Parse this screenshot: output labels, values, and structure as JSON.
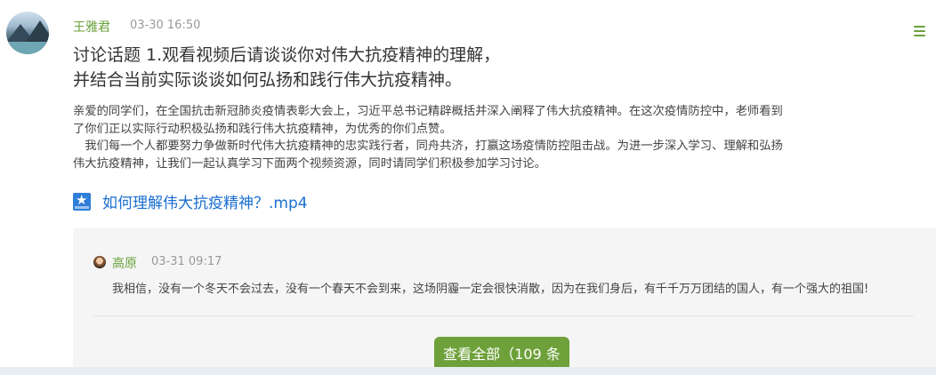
{
  "post": {
    "author": "王雅君",
    "time": "03-30 16:50",
    "title_line1": "讨论话题 1.观看视频后请谈谈你对伟大抗疫精神的理解，",
    "title_line2": "并结合当前实际谈谈如何弘扬和践行伟大抗疫精神。",
    "body_p1_line1": "亲爱的同学们，在全国抗击新冠肺炎疫情表彰大会上，习近平总书记精辟概括并深入阐释了伟大抗疫精神。在这次疫情防控中，老师看到",
    "body_p1_line2": "了你们正以实际行动积极弘扬和践行伟大抗疫精神，为优秀的你们点赞。",
    "body_p2_line1": "　我们每一个人都要努力争做新时代伟大抗疫精神的忠实践行者，同舟共济，打赢这场疫情防控阻击战。为进一步深入学习、理解和弘扬",
    "body_p2_line2": "伟大抗疫精神，让我们一起认真学习下面两个视频资源，同时请同学们积极参加学习讨论。",
    "attachment_name": "如何理解伟大抗疫精神？.mp4",
    "attachment_icon": "video-file-icon"
  },
  "comment": {
    "author": "高原",
    "time": "03-31 09:17",
    "text": "我相信，没有一个冬天不会过去，没有一个春天不会到来，这场阴霾一定会很快消散，因为在我们身后，有千千万万团结的国人，有一个强大的祖国!"
  },
  "view_all_label": "查看全部（109 条",
  "colors": {
    "accent": "#6aa13a",
    "link": "#1a6ed1"
  }
}
